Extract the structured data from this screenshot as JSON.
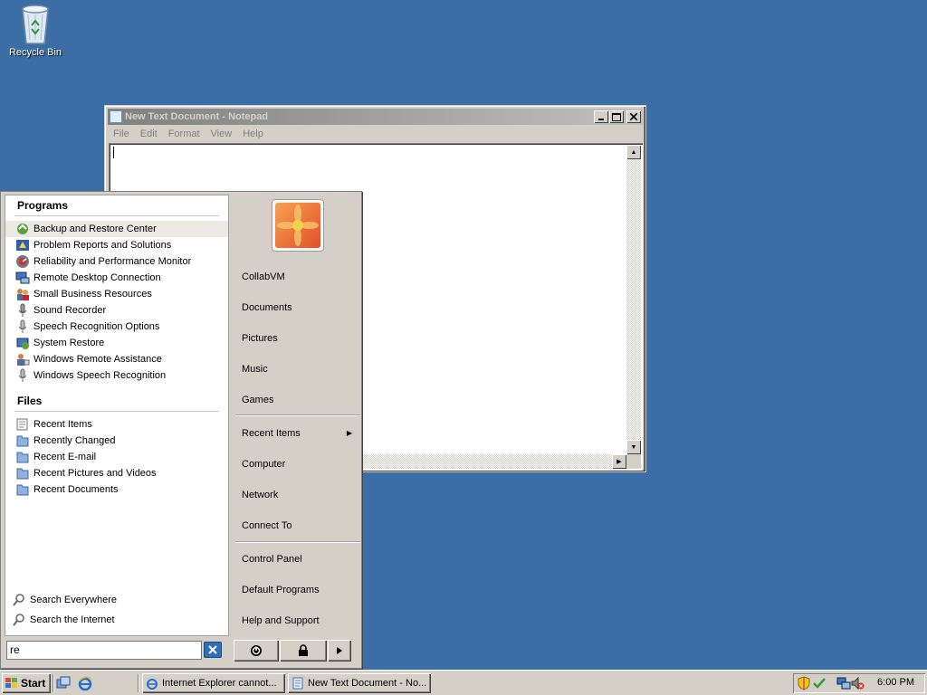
{
  "desktop": {
    "recycle_bin_label": "Recycle Bin"
  },
  "notepad": {
    "title": "New Text Document - Notepad",
    "menu": [
      "File",
      "Edit",
      "Format",
      "View",
      "Help"
    ],
    "content": ""
  },
  "start_menu": {
    "programs_heading": "Programs",
    "programs": [
      {
        "label": "Backup and Restore Center",
        "icon": "backup-icon",
        "highlighted": true
      },
      {
        "label": "Problem Reports and Solutions",
        "icon": "problem-reports-icon"
      },
      {
        "label": "Reliability and Performance Monitor",
        "icon": "performance-monitor-icon"
      },
      {
        "label": "Remote Desktop Connection",
        "icon": "remote-desktop-icon"
      },
      {
        "label": "Small Business Resources",
        "icon": "business-resources-icon"
      },
      {
        "label": "Sound Recorder",
        "icon": "microphone-icon"
      },
      {
        "label": "Speech Recognition Options",
        "icon": "microphone-icon"
      },
      {
        "label": "System Restore",
        "icon": "system-restore-icon"
      },
      {
        "label": "Windows Remote Assistance",
        "icon": "remote-assistance-icon"
      },
      {
        "label": "Windows Speech Recognition",
        "icon": "microphone-icon"
      }
    ],
    "files_heading": "Files",
    "files": [
      {
        "label": "Recent Items",
        "icon": "recent-items-icon"
      },
      {
        "label": "Recently Changed",
        "icon": "search-folder-icon"
      },
      {
        "label": "Recent E-mail",
        "icon": "search-folder-icon"
      },
      {
        "label": "Recent Pictures and Videos",
        "icon": "search-folder-icon"
      },
      {
        "label": "Recent Documents",
        "icon": "search-folder-icon"
      }
    ],
    "search_everywhere": "Search Everywhere",
    "search_internet": "Search the Internet",
    "search_value": "re",
    "right_items": {
      "user": "CollabVM",
      "documents": "Documents",
      "pictures": "Pictures",
      "music": "Music",
      "games": "Games",
      "recent_items": "Recent Items",
      "computer": "Computer",
      "network": "Network",
      "connect_to": "Connect To",
      "control_panel": "Control Panel",
      "default_programs": "Default Programs",
      "help_support": "Help and Support"
    }
  },
  "taskbar": {
    "start_label": "Start",
    "tasks": [
      {
        "label": "Internet Explorer cannot...",
        "icon": "internet-explorer-icon"
      },
      {
        "label": "New Text Document - No...",
        "icon": "notepad-icon"
      }
    ],
    "clock": "6:00 PM"
  }
}
